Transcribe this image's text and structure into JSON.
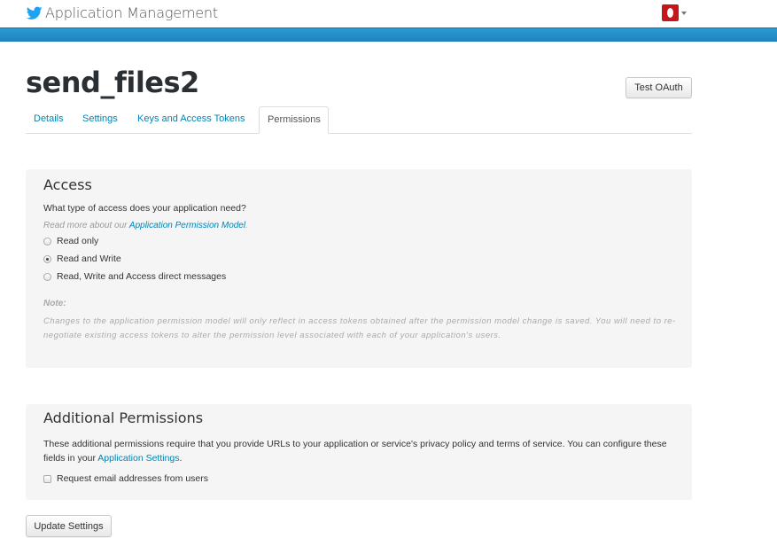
{
  "header": {
    "app_title": "Application Management",
    "logo_icon": "twitter-bird-icon",
    "brand_color": "#1da1f2",
    "band_color": "#2b9bd4"
  },
  "user_menu": {
    "avatar_icon": "user-avatar-icon",
    "avatar_color": "#c4161c"
  },
  "page": {
    "title": "send_files2",
    "test_oauth_label": "Test OAuth"
  },
  "tabs": [
    {
      "label": "Details",
      "active": false
    },
    {
      "label": "Settings",
      "active": false
    },
    {
      "label": "Keys and Access Tokens",
      "active": false
    },
    {
      "label": "Permissions",
      "active": true
    }
  ],
  "access": {
    "heading": "Access",
    "question": "What type of access does your application need?",
    "read_more_prefix": "Read more about our ",
    "read_more_link": "Application Permission Model",
    "read_more_suffix": ".",
    "options": [
      {
        "label": "Read only",
        "checked": false
      },
      {
        "label": "Read and Write",
        "checked": true
      },
      {
        "label": "Read, Write and Access direct messages",
        "checked": false
      }
    ],
    "note_label": "Note:",
    "note_text": "Changes to the application permission model will only reflect in access tokens obtained after the permission model change is saved. You will need to re-negotiate existing access tokens to alter the permission level associated with each of your application's users."
  },
  "additional": {
    "heading": "Additional Permissions",
    "text_prefix": "These additional permissions require that you provide URLs to your application or service's privacy policy and terms of service. You can configure these fields in your ",
    "text_link": "Application Settings",
    "text_suffix": ".",
    "checkbox_label": "Request email addresses from users",
    "checkbox_checked": false
  },
  "footer": {
    "update_label": "Update Settings"
  }
}
